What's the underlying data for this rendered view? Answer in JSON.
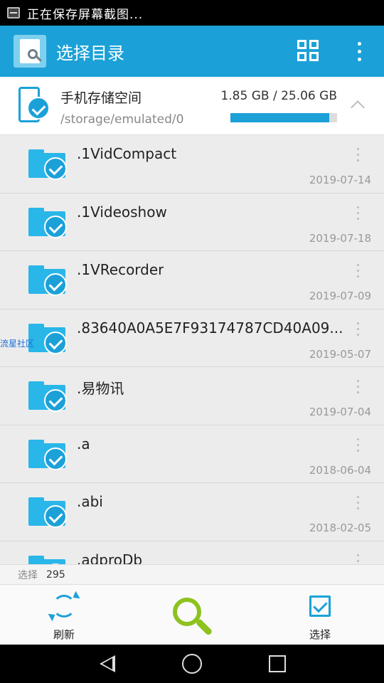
{
  "status_bar": {
    "text": "正在保存屏幕截图..."
  },
  "toolbar": {
    "title": "选择目录"
  },
  "storage": {
    "name": "手机存储空间",
    "path": "/storage/emulated/0",
    "usage": "1.85 GB / 25.06 GB",
    "used_fraction": 0.926
  },
  "folders": [
    {
      "name": ".1VidCompact",
      "date": "2019-07-14"
    },
    {
      "name": ".1Videoshow",
      "date": "2019-07-18"
    },
    {
      "name": ".1VRecorder",
      "date": "2019-07-09"
    },
    {
      "name": ".83640A0A5E7F93174787CD40A09...",
      "date": "2019-05-07"
    },
    {
      "name": ".易物讯",
      "date": "2019-07-04"
    },
    {
      "name": ".a",
      "date": "2018-06-04"
    },
    {
      "name": ".abi",
      "date": "2018-02-05"
    },
    {
      "name": ".adproDb",
      "date": ""
    }
  ],
  "watermark": "流星社区",
  "selection": {
    "label": "选择",
    "count": "295"
  },
  "actions": {
    "refresh": "刷新",
    "select": "选择"
  },
  "colors": {
    "primary": "#1ba1d8",
    "search": "#8dc21f"
  }
}
